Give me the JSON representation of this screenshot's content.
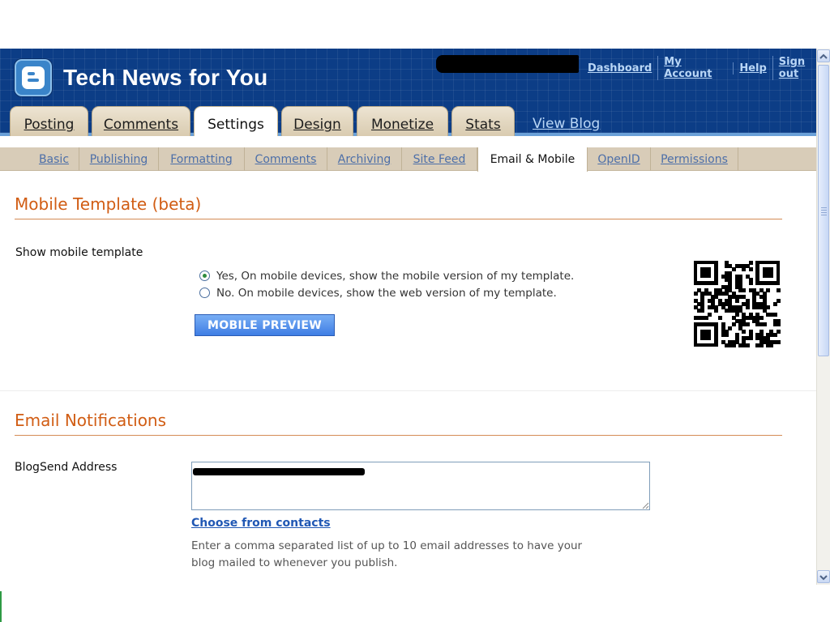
{
  "header": {
    "blog_title": "Tech News for You",
    "links": [
      "Dashboard",
      "My Account",
      "Help",
      "Sign out"
    ],
    "view_blog": "View Blog"
  },
  "tabs": [
    {
      "label": "Posting",
      "active": false
    },
    {
      "label": "Comments",
      "active": false
    },
    {
      "label": "Settings",
      "active": true
    },
    {
      "label": "Design",
      "active": false
    },
    {
      "label": "Monetize",
      "active": false
    },
    {
      "label": "Stats",
      "active": false
    }
  ],
  "subnav": [
    {
      "label": "Basic",
      "active": false
    },
    {
      "label": "Publishing",
      "active": false
    },
    {
      "label": "Formatting",
      "active": false
    },
    {
      "label": "Comments",
      "active": false
    },
    {
      "label": "Archiving",
      "active": false
    },
    {
      "label": "Site Feed",
      "active": false
    },
    {
      "label": "Email & Mobile",
      "active": true
    },
    {
      "label": "OpenID",
      "active": false
    },
    {
      "label": "Permissions",
      "active": false
    }
  ],
  "mobile": {
    "section_title": "Mobile Template (beta)",
    "field_label": "Show mobile template",
    "option_yes": "Yes, On mobile devices, show the mobile version of my template.",
    "option_no": "No. On mobile devices, show the web version of my template.",
    "selected": "yes",
    "preview_button": "MOBILE PREVIEW"
  },
  "email": {
    "section_title": "Email Notifications",
    "blogsend_label": "BlogSend Address",
    "blogsend_value": "",
    "choose_contacts": "Choose from contacts",
    "help_line1": "Enter a comma separated list of up to 10 email addresses to have your",
    "help_line2": "blog mailed to whenever you publish."
  },
  "colors": {
    "header_bg": "#0c3d86",
    "section_title": "#d15d14",
    "link": "#2158b4",
    "button": "#3f7ee4"
  }
}
